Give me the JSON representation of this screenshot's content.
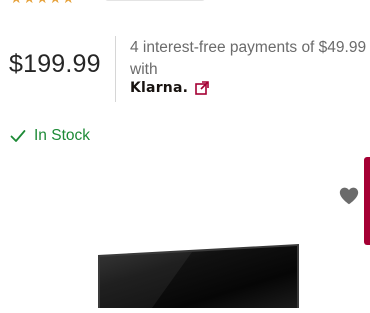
{
  "rating": {
    "stars": 5
  },
  "pricing": {
    "price": "$199.99",
    "financing_text": "4 interest-free payments of $49.99 with",
    "provider_logo": "Klarna.",
    "external_link_icon": "external-link-icon"
  },
  "availability": {
    "status": "In Stock",
    "icon": "check-icon"
  },
  "product_image": {
    "wishlist_icon": "heart-icon"
  },
  "colors": {
    "star": "#e6a23c",
    "in_stock": "#1d8a36",
    "brand_accent": "#a50034",
    "heart": "#6b6b6b"
  }
}
